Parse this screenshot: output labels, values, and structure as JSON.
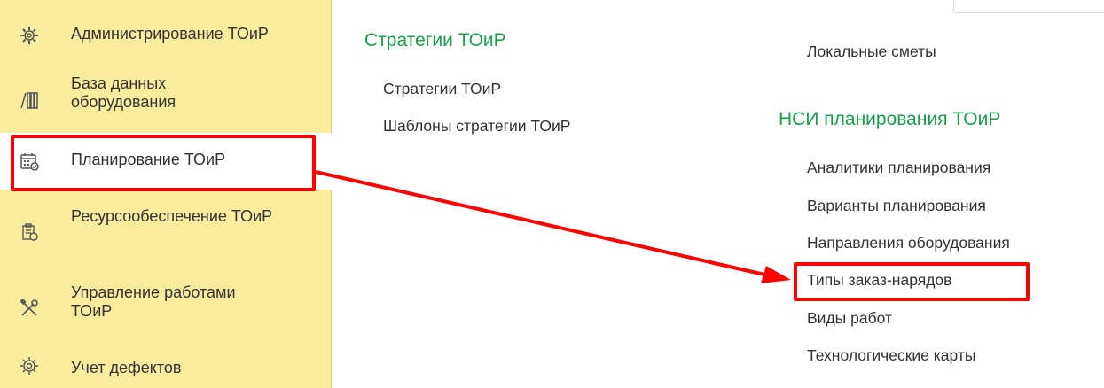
{
  "sidebar": {
    "items": [
      {
        "label": "Администрирование ТОиР",
        "icon": "gear-icon"
      },
      {
        "label": "База данных оборудования",
        "icon": "books-icon"
      },
      {
        "label": "Планирование ТОиР",
        "icon": "calendar-icon",
        "active": true
      },
      {
        "label": "Ресурсообеспечение ТОиР",
        "icon": "resources-icon"
      },
      {
        "label": "Управление работами ТОиР",
        "icon": "tools-icon"
      },
      {
        "label": "Учет дефектов",
        "icon": "defect-gear-icon"
      }
    ]
  },
  "content": {
    "strategies": {
      "title": "Стратегии ТОиР",
      "links": [
        "Стратегии ТОиР",
        "Шаблоны стратегии ТОиР"
      ]
    },
    "estimates": {
      "links": [
        "Локальные сметы"
      ]
    },
    "nsi": {
      "title": "НСИ планирования ТОиР",
      "links": [
        "Аналитики планирования",
        "Варианты планирования",
        "Направления оборудования",
        "Типы заказ-нарядов",
        "Виды работ",
        "Технологические карты"
      ]
    }
  },
  "colors": {
    "sidebar_bg": "#fbec9e",
    "group_title": "#1a9e4a",
    "highlight": "#ff0000",
    "text": "#333333"
  }
}
